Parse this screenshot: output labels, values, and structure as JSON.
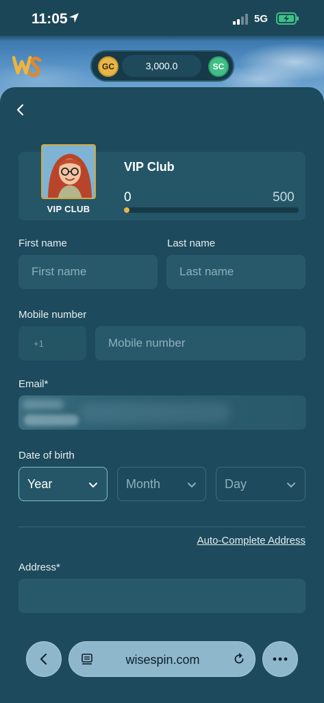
{
  "status_bar": {
    "time": "11:05",
    "network": "5G"
  },
  "header": {
    "gc_label": "GC",
    "balance": "3,000.0",
    "sc_label": "SC"
  },
  "vip": {
    "badge_label": "VIP CLUB",
    "title": "VIP Club",
    "progress_min": "0",
    "progress_max": "500",
    "progress_value": 0
  },
  "form": {
    "first_name_label": "First name",
    "first_name_placeholder": "First name",
    "last_name_label": "Last name",
    "last_name_placeholder": "Last name",
    "mobile_label": "Mobile number",
    "country_code_placeholder": "+1",
    "mobile_placeholder": "Mobile number",
    "email_label": "Email*",
    "dob_label": "Date of birth",
    "year": "Year",
    "month": "Month",
    "day": "Day",
    "autocomplete_link": "Auto-Complete Address",
    "address_label": "Address*"
  },
  "browser": {
    "url": "wisespin.com"
  },
  "colors": {
    "background": "#1b4658",
    "panel": "#1d4a5c",
    "field": "#28596b",
    "gold": "#e6b64a",
    "green": "#3fbf86"
  }
}
